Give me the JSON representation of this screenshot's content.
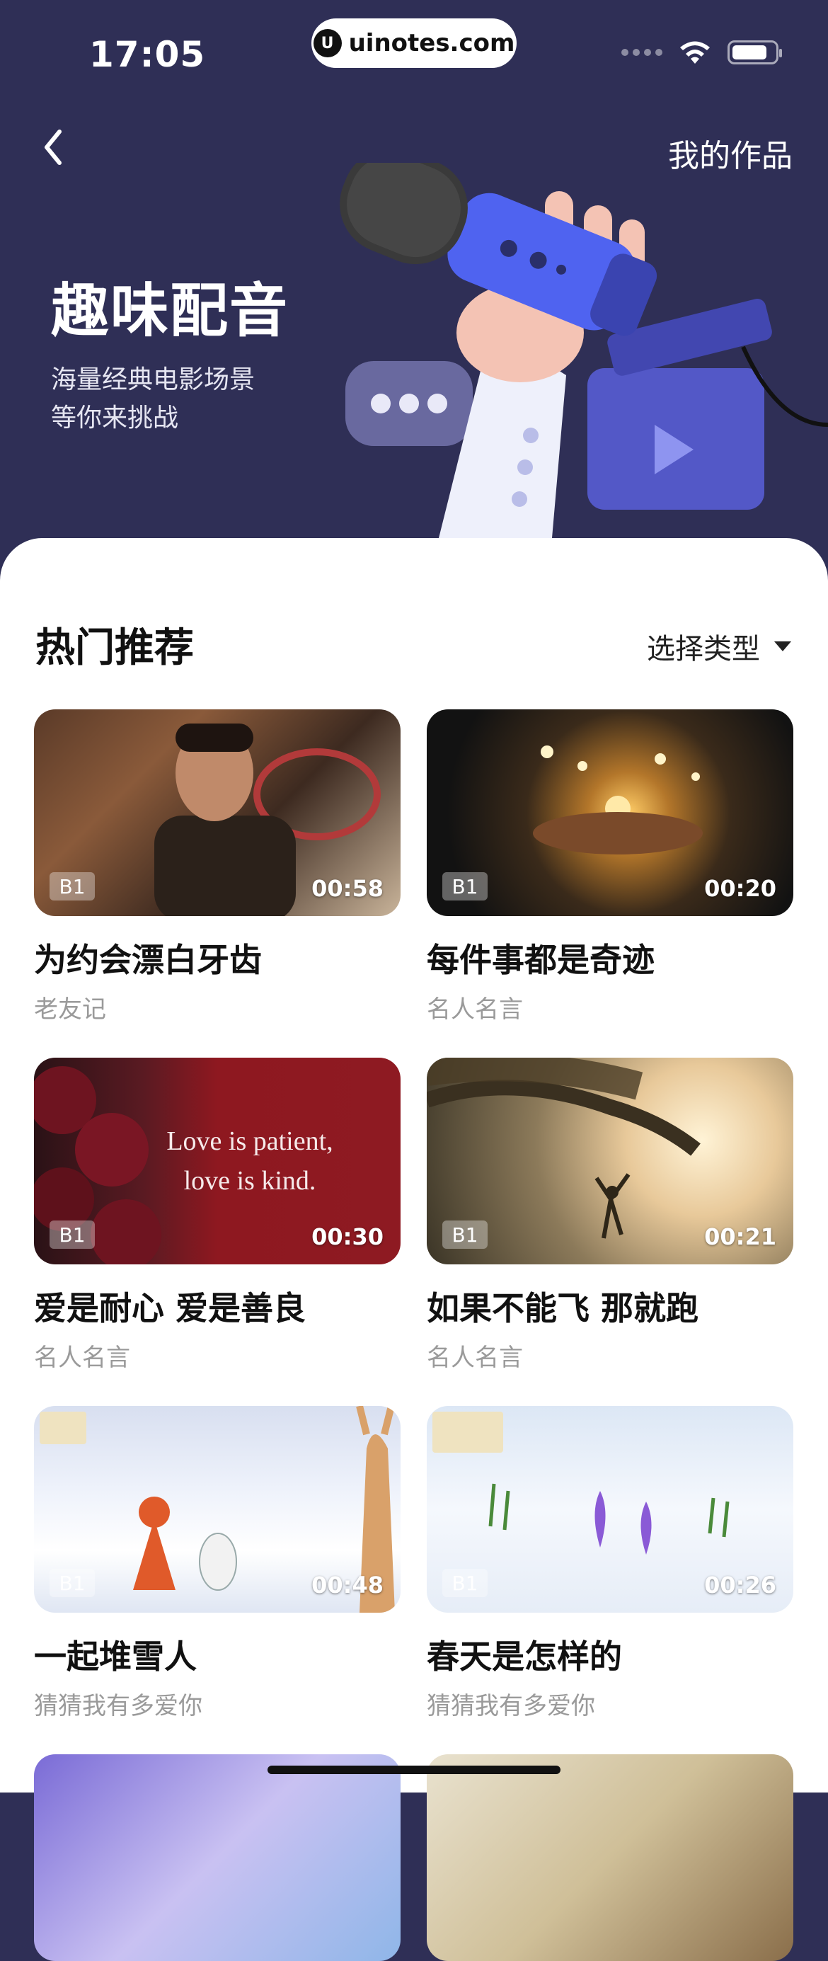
{
  "status_bar": {
    "time": "17:05"
  },
  "watermark": {
    "text": "uinotes.com",
    "logo": "U"
  },
  "header": {
    "my_works": "我的作品"
  },
  "hero": {
    "title": "趣味配音",
    "subtitle_line1": "海量经典电影场景",
    "subtitle_line2": "等你来挑战"
  },
  "section": {
    "title": "热门推荐",
    "filter_label": "选择类型"
  },
  "cards": [
    {
      "badge": "B1",
      "duration": "00:58",
      "title": "为约会漂白牙齿",
      "category": "老友记"
    },
    {
      "badge": "B1",
      "duration": "00:20",
      "title": "每件事都是奇迹",
      "category": "名人名言"
    },
    {
      "badge": "B1",
      "duration": "00:30",
      "title": "爱是耐心 爱是善良",
      "category": "名人名言",
      "overlay_line1": "Love is patient,",
      "overlay_line2": "love is kind."
    },
    {
      "badge": "B1",
      "duration": "00:21",
      "title": "如果不能飞 那就跑",
      "category": "名人名言"
    },
    {
      "badge": "B1",
      "duration": "00:48",
      "title": "一起堆雪人",
      "category": "猜猜我有多爱你"
    },
    {
      "badge": "B1",
      "duration": "00:26",
      "title": "春天是怎样的",
      "category": "猜猜我有多爱你"
    },
    {
      "badge": "",
      "duration": "",
      "title": "",
      "category": ""
    },
    {
      "badge": "",
      "duration": "",
      "title": "",
      "category": ""
    }
  ],
  "icons": [
    "back-chevron-icon",
    "wifi-icon",
    "battery-icon",
    "signal-icon",
    "dropdown-arrow-icon"
  ],
  "colors": {
    "hero_bg": "#2f2f56",
    "accent": "#5b6cf0",
    "text": "#111111",
    "muted": "#9a9a9a"
  }
}
